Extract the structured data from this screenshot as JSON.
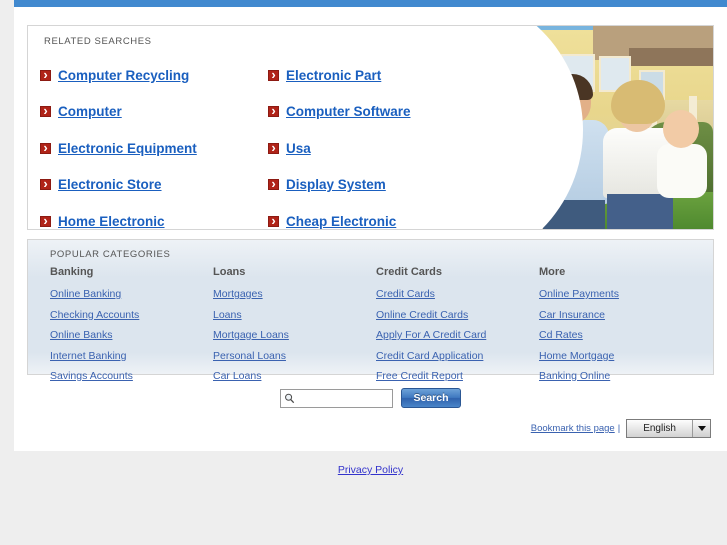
{
  "top_bar": {
    "color": "#4189cf"
  },
  "related": {
    "title": "RELATED SEARCHES",
    "columns": [
      {
        "links": [
          "Computer Recycling",
          "Computer",
          "Electronic Equipment",
          "Electronic Store",
          "Home Electronic"
        ]
      },
      {
        "links": [
          "Electronic Part",
          "Computer Software",
          "Usa",
          "Display System",
          "Cheap Electronic"
        ]
      }
    ],
    "bullet_icon": "red-arrow-bullet-icon",
    "link_color": "#1a5fbf",
    "bullet_color": "#b02318"
  },
  "hero": {
    "alt": "family-photo",
    "description": "Family with baby in front of a yellow house"
  },
  "categories": {
    "title": "POPULAR CATEGORIES",
    "columns": [
      {
        "heading": "Banking",
        "links": [
          "Online Banking",
          "Checking Accounts",
          "Online Banks",
          "Internet Banking",
          "Savings Accounts"
        ]
      },
      {
        "heading": "Loans",
        "links": [
          "Mortgages",
          "Loans",
          "Mortgage Loans",
          "Personal Loans",
          "Car Loans"
        ]
      },
      {
        "heading": "Credit Cards",
        "links": [
          "Credit Cards",
          "Online Credit Cards",
          "Apply For A Credit Card",
          "Credit Card Application",
          "Free Credit Report"
        ]
      },
      {
        "heading": "More",
        "links": [
          "Online Payments",
          "Car Insurance",
          "Cd Rates",
          "Home Mortgage",
          "Banking Online"
        ]
      }
    ],
    "link_color": "#3a62b0"
  },
  "search": {
    "value": "",
    "placeholder": "",
    "button_label": "Search",
    "icon": "magnifier-icon"
  },
  "bottom": {
    "bookmark_label": "Bookmark this page",
    "separator": "|",
    "language_selected": "English",
    "language_options": [
      "English"
    ]
  },
  "footer": {
    "privacy_label": "Privacy Policy",
    "privacy_color": "#3333cc"
  }
}
